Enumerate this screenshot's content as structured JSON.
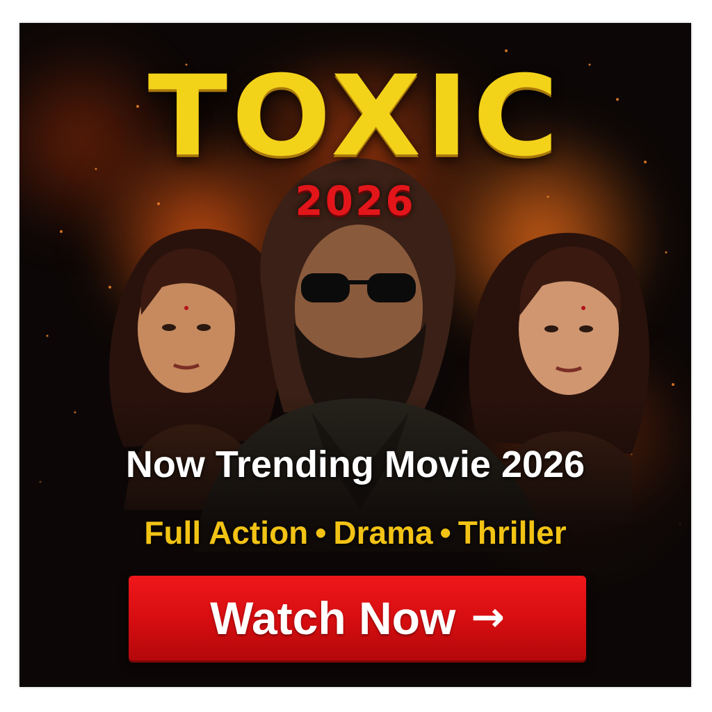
{
  "poster": {
    "title": "TOXIC",
    "year": "2026",
    "headline": "Now Trending Movie 2026",
    "genres": [
      "Full Action",
      "Drama",
      "Thriller"
    ],
    "genre_separator": "•",
    "cta_label": "Watch Now",
    "cta_icon": "arrow-right-icon",
    "cta_arrow": "→"
  },
  "colors": {
    "title": "#f3d21a",
    "year": "#e2161a",
    "genres": "#f2c315",
    "button": "#d40d10",
    "background": "#0c0706"
  }
}
